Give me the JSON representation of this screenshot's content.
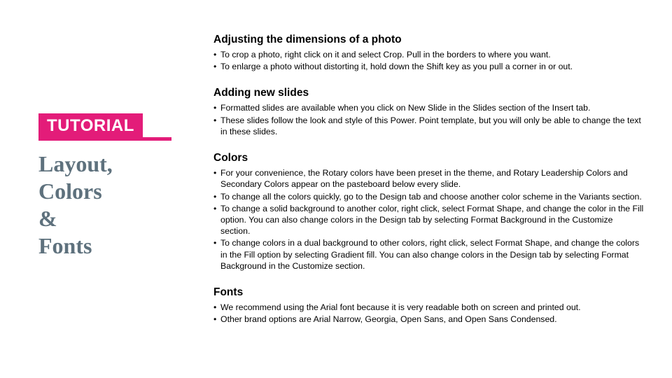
{
  "left": {
    "badge": "TUTORIAL",
    "title_lines": [
      "Layout,",
      "Colors",
      "&",
      "Fonts"
    ]
  },
  "sections": [
    {
      "heading": "Adjusting the dimensions of a photo",
      "bullets": [
        "To crop a photo, right click on it and select Crop. Pull in the borders to where you want.",
        "To enlarge a photo without distorting it, hold down the Shift key as you pull a corner in or out."
      ]
    },
    {
      "heading": "Adding new slides",
      "bullets": [
        "Formatted slides are available when you click on New Slide in the Slides section of the Insert tab.",
        "These slides follow the look and style of this Power. Point template, but you will only be able to change the text in these slides."
      ]
    },
    {
      "heading": "Colors",
      "bullets": [
        "For your convenience, the Rotary colors have been preset in the theme, and Rotary Leadership Colors and Secondary Colors appear on the pasteboard below every slide.",
        "To change all the colors quickly, go to the Design tab and choose another color scheme in the Variants section.",
        "To change a solid background to another color, right click, select Format Shape, and change the color in the Fill option. You can also change colors in the Design tab by selecting Format Background in the Customize section.",
        "To change colors in a dual background to other colors, right click, select Format Shape, and change the colors in the Fill option by selecting Gradient fill. You can also change colors in the Design tab by selecting Format Background in the Customize section."
      ]
    },
    {
      "heading": "Fonts",
      "bullets": [
        "We recommend using the Arial font because it is very readable both on screen and printed out.",
        "Other brand options are Arial Narrow, Georgia, Open Sans, and Open Sans Condensed."
      ]
    }
  ]
}
